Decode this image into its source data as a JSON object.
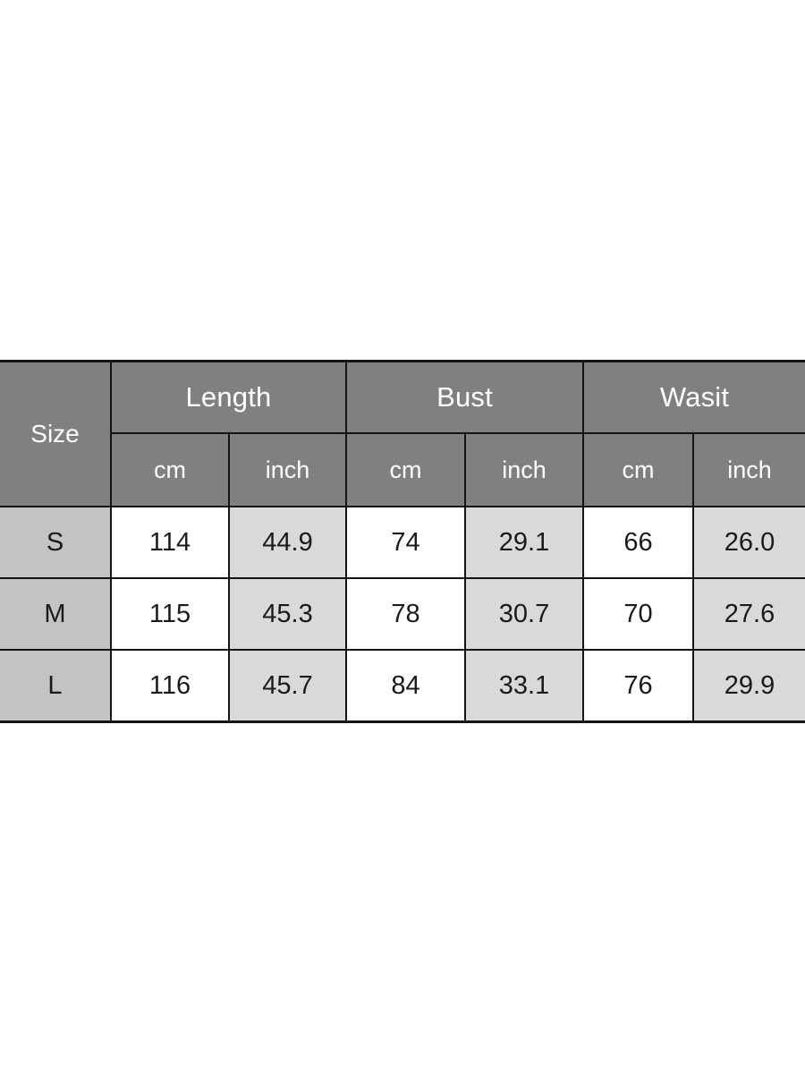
{
  "chart_data": {
    "type": "table",
    "title": "",
    "size_column_header": "Size",
    "measurement_groups": [
      "Length",
      "Bust",
      "Wasit"
    ],
    "units": [
      "cm",
      "inch"
    ],
    "columns": [
      "Size",
      "Length cm",
      "Length inch",
      "Bust cm",
      "Bust inch",
      "Wasit cm",
      "Wasit inch"
    ],
    "rows": [
      {
        "size": "S",
        "length_cm": "114",
        "length_inch": "44.9",
        "bust_cm": "74",
        "bust_inch": "29.1",
        "waist_cm": "66",
        "waist_inch": "26.0"
      },
      {
        "size": "M",
        "length_cm": "115",
        "length_inch": "45.3",
        "bust_cm": "78",
        "bust_inch": "30.7",
        "waist_cm": "70",
        "waist_inch": "27.6"
      },
      {
        "size": "L",
        "length_cm": "116",
        "length_inch": "45.7",
        "bust_cm": "84",
        "bust_inch": "33.1",
        "waist_cm": "76",
        "waist_inch": "29.9"
      }
    ]
  },
  "table": {
    "size_header": "Size",
    "groups": {
      "length": "Length",
      "bust": "Bust",
      "waist": "Wasit"
    },
    "units": {
      "length_cm": "cm",
      "length_inch": "inch",
      "bust_cm": "cm",
      "bust_inch": "inch",
      "waist_cm": "cm",
      "waist_inch": "inch"
    },
    "rows": [
      {
        "size": "S",
        "length_cm": "114",
        "length_inch": "44.9",
        "bust_cm": "74",
        "bust_inch": "29.1",
        "waist_cm": "66",
        "waist_inch": "26.0"
      },
      {
        "size": "M",
        "length_cm": "115",
        "length_inch": "45.3",
        "bust_cm": "78",
        "bust_inch": "30.7",
        "waist_cm": "70",
        "waist_inch": "27.6"
      },
      {
        "size": "L",
        "length_cm": "116",
        "length_inch": "45.7",
        "bust_cm": "84",
        "bust_inch": "33.1",
        "waist_cm": "76",
        "waist_inch": "29.9"
      }
    ]
  },
  "colors": {
    "header_background": "#808080",
    "header_text": "#ffffff",
    "size_cell_background": "#c3c3c3",
    "cm_cell_background": "#ffffff",
    "inch_cell_background": "#d9d9d9",
    "cell_text": "#1a1a1a",
    "border": "#141414",
    "page_background": "#ffffff"
  }
}
